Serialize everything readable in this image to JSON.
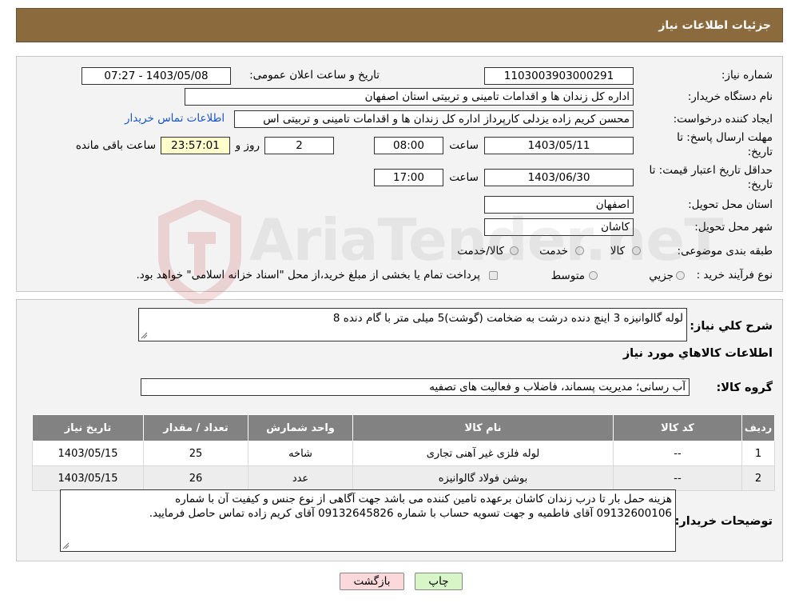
{
  "header": {
    "title": "جزئیات اطلاعات نیاز"
  },
  "form": {
    "need_number_label": "شماره نیاز:",
    "need_number": "1103003903000291",
    "announce_label": "تاریخ و ساعت اعلان عمومی:",
    "announce_value": "1403/05/08 - 07:27",
    "buyer_org_label": "نام دستگاه خریدار:",
    "buyer_org": "اداره کل زندان ها و اقدامات تامینی و تربیتی استان اصفهان",
    "requester_label": "ایجاد کننده درخواست:",
    "requester": "محسن کریم زاده یزدلی کارپرداز اداره کل زندان ها و اقدامات تامینی و تربیتی اس",
    "contact_link": "اطلاعات تماس خریدار",
    "deadline_label_1": "مهلت ارسال پاسخ: تا",
    "deadline_label_2": "تاریخ:",
    "deadline_date": "1403/05/11",
    "time_label": "ساعت",
    "deadline_time": "08:00",
    "days_value": "2",
    "days_label": "روز و",
    "remaining_value": "23:57:01",
    "remaining_label": "ساعت باقی مانده",
    "validity_label_1": "حداقل تاریخ اعتبار قیمت: تا",
    "validity_label_2": "تاریخ:",
    "validity_date": "1403/06/30",
    "validity_time": "17:00",
    "province_label": "استان محل تحویل:",
    "province": "اصفهان",
    "city_label": "شهر محل تحویل:",
    "city": "کاشان",
    "category_label": "طبقه بندی موضوعی:",
    "category_options": [
      "کالا",
      "خدمت",
      "کالا/خدمت"
    ],
    "process_label": "نوع فرآیند خرید :",
    "process_options": [
      "جزیي",
      "متوسط"
    ],
    "process_note": "پرداخت تمام یا بخشی از مبلغ خرید،از محل \"اسناد خزانه اسلامی\" خواهد بود."
  },
  "summary": {
    "desc_label": "شرح کلي نياز:",
    "desc_value": "لوله گالوانیزه 3 اینچ دنده درشت به ضخامت (گوشت)5 میلی متر با گام دنده  8",
    "goods_info_title": "اطلاعات کالاهاي مورد نياز",
    "group_label": "گروه کالا:",
    "group_value": "آب رسانی؛ مدیریت پسماند، فاضلاب و فعالیت های تصفیه"
  },
  "table": {
    "headers": [
      "رديف",
      "کد کالا",
      "نام کالا",
      "واحد شمارش",
      "تعداد / مقدار",
      "تاريخ نياز"
    ],
    "rows": [
      [
        "1",
        "--",
        "لوله فلزی غیر آهنی تجاری",
        "شاخه",
        "25",
        "1403/05/15"
      ],
      [
        "2",
        "--",
        "بوشن فولاد گالوانیزه",
        "عدد",
        "26",
        "1403/05/15"
      ]
    ]
  },
  "buyer_notes": {
    "label": "توضيحات خريدار:",
    "line1": "هزینه حمل بار تا درب زندان کاشان برعهده تامین کننده می باشد جهت آگاهی از نوع جنس و کیفیت آن با شماره",
    "line2": "09132600106 آقای فاطمیه و جهت تسویه حساب با شماره 09132645826 آقای کریم زاده تماس حاصل فرمایید."
  },
  "buttons": {
    "back": "بازگشت",
    "print": "چاپ"
  },
  "watermark": {
    "text": "AriaTender.neT"
  },
  "colors": {
    "header_bg": "#8b6a3e",
    "back_btn_bg": "#fbd9db",
    "print_btn_bg": "#d8f5c8",
    "link": "#1a56c4"
  }
}
